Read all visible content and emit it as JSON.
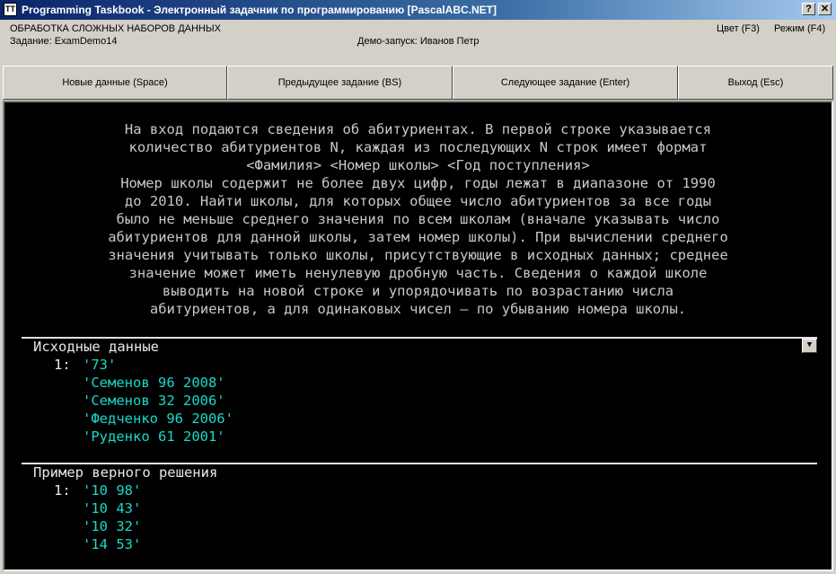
{
  "window": {
    "title": "Programming Taskbook - Электронный задачник по программированию [PascalABC.NET]",
    "icon_glyph": "TT",
    "help_glyph": "?",
    "close_glyph": "✕"
  },
  "info": {
    "group": "ОБРАБОТКА СЛОЖНЫХ НАБОРОВ ДАННЫХ",
    "task": "Задание: ExamDemo14",
    "demo": "Демо-запуск: Иванов Петр",
    "color": "Цвет (F3)",
    "mode": "Режим (F4)"
  },
  "buttons": {
    "new_data": "Новые данные (Space)",
    "prev_task": "Предыдущее задание (BS)",
    "next_task": "Следующее задание (Enter)",
    "exit": "Выход (Esc)"
  },
  "description": [
    "На вход подаются сведения об абитуриентах. В первой строке указывается",
    "количество абитуриентов N, каждая из последующих N строк имеет формат",
    "<Фамилия> <Номер школы> <Год поступления>",
    "Номер школы содержит не более двух цифр, годы лежат в диапазоне от 1990",
    "до 2010. Найти школы, для которых общее число абитуриентов за все годы",
    "было не меньше среднего значения по всем школам (вначале указывать число",
    "абитуриентов для данной школы, затем номер школы). При вычислении среднего",
    "значения учитывать только школы, присутствующие в исходных данных; среднее",
    "значение может иметь ненулевую дробную часть. Сведения о каждой школе",
    "выводить на новой строке и упорядочивать по возрастанию числа",
    "абитуриентов, а для одинаковых чисел — по убыванию номера школы."
  ],
  "input_section": {
    "title": "Исходные данные",
    "index": "1:",
    "scroll_glyph": "▼",
    "lines": [
      "'73'",
      "'Семенов 96 2008'",
      "'Семенов 32 2006'",
      "'Федченко 96 2006'",
      "'Руденко 61 2001'"
    ]
  },
  "output_section": {
    "title": "Пример верного решения",
    "index": "1:",
    "lines": [
      "'10 98'",
      "'10 43'",
      "'10 32'",
      "'14 53'"
    ]
  }
}
